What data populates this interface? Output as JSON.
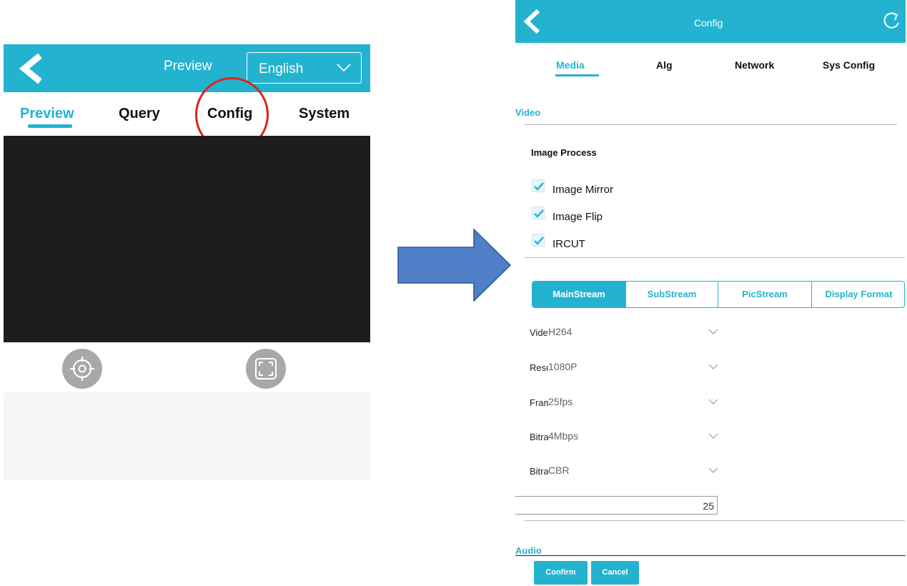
{
  "left_panel": {
    "header_title": "Preview",
    "language": "English",
    "tabs": [
      {
        "label": "Preview",
        "active": true
      },
      {
        "label": "Query",
        "active": false
      },
      {
        "label": "Config",
        "active": false
      },
      {
        "label": "System",
        "active": false
      }
    ],
    "highlighted_tab": "Config",
    "controls": [
      {
        "icon": "crosshair-icon"
      },
      {
        "icon": "fullscreen-icon"
      }
    ]
  },
  "arrow_icon": "right-arrow-icon",
  "right_panel": {
    "header_title": "Config",
    "tabs": [
      {
        "label": "Media",
        "active": true
      },
      {
        "label": "Alg",
        "active": false
      },
      {
        "label": "Network",
        "active": false
      },
      {
        "label": "Sys Config",
        "active": false
      }
    ],
    "video_section": "Video",
    "image_process": {
      "title": "Image Process",
      "options": [
        {
          "label": "Image Mirror",
          "checked": true
        },
        {
          "label": "Image Flip",
          "checked": true
        },
        {
          "label": "IRCUT",
          "checked": true
        }
      ]
    },
    "stream_tabs": [
      {
        "label": "MainStream",
        "active": true
      },
      {
        "label": "SubStream",
        "active": false
      },
      {
        "label": "PicStream",
        "active": false
      },
      {
        "label": "Display Format",
        "active": false
      }
    ],
    "fields": [
      {
        "label": "Video",
        "value": "H264"
      },
      {
        "label": "Resolution",
        "value": "1080P"
      },
      {
        "label": "Frame Rate",
        "value": "25fps"
      },
      {
        "label": "Bitrate",
        "value": "4Mbps"
      },
      {
        "label": "Bitrate Type",
        "value": "CBR"
      }
    ],
    "number_input_value": "25",
    "audio_section": "Audio",
    "buttons": {
      "confirm": "Confirm",
      "cancel": "Cancel"
    }
  },
  "colors": {
    "accent": "#23b3d0",
    "highlight_circle": "#e0211d",
    "arrow_fill": "#4f7fc6",
    "video_bg": "#1f1c1d"
  }
}
